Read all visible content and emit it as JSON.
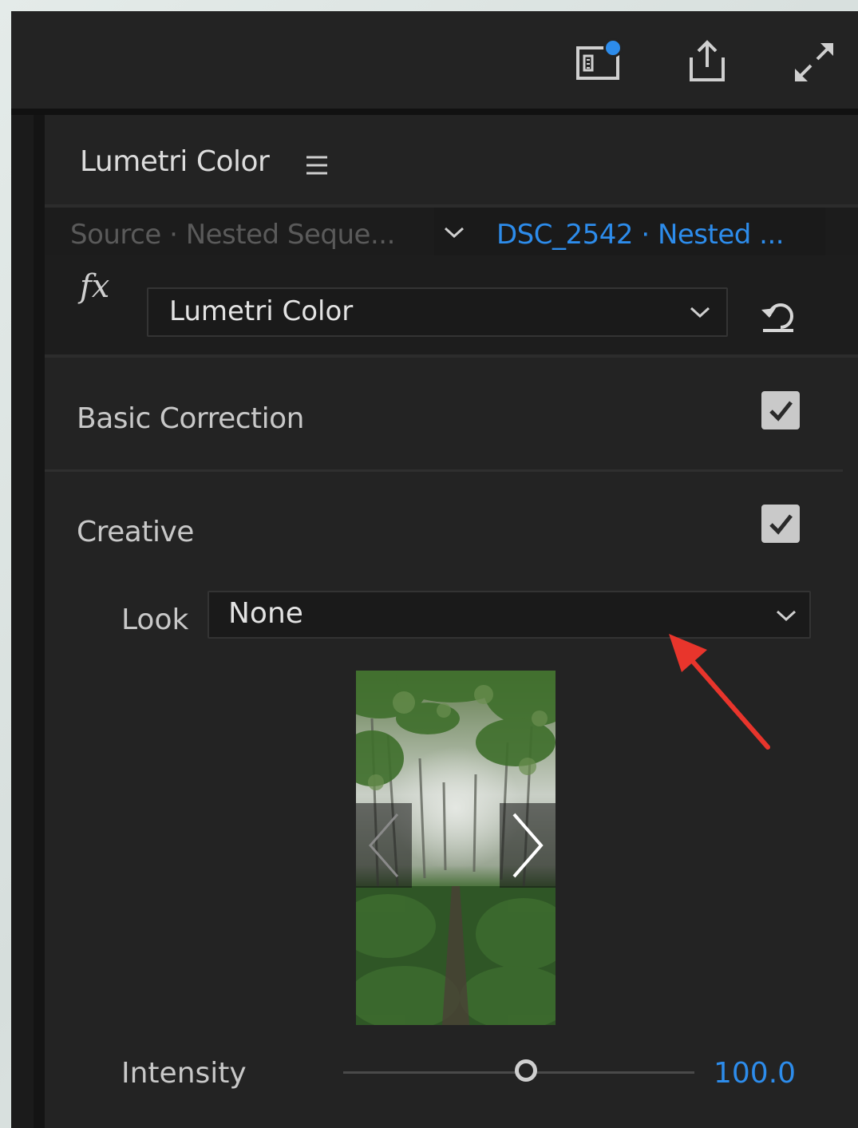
{
  "toolbar": {
    "icons": [
      "quick-export-icon",
      "share-icon",
      "fullscreen-icon"
    ],
    "notification_color": "#2d8ceb"
  },
  "panel": {
    "title": "Lumetri Color",
    "menu_icon": "hamburger-menu-icon"
  },
  "source": {
    "label": "Source · Nested Seque...",
    "clip_label": "DSC_2542 · Nested ..."
  },
  "effect": {
    "fx_label": "fx",
    "selected": "Lumetri Color",
    "reset_icon": "reset-icon"
  },
  "sections": {
    "basic_correction": {
      "label": "Basic Correction",
      "enabled": true
    },
    "creative": {
      "label": "Creative",
      "enabled": true
    }
  },
  "look": {
    "label": "Look",
    "selected": "None"
  },
  "preview": {
    "prev_icon": "chevron-left-icon",
    "next_icon": "chevron-right-icon"
  },
  "intensity": {
    "label": "Intensity",
    "value": "100.0",
    "slider_fraction": 0.52
  },
  "colors": {
    "accent": "#2d8ceb",
    "annotation": "#e8352c"
  }
}
